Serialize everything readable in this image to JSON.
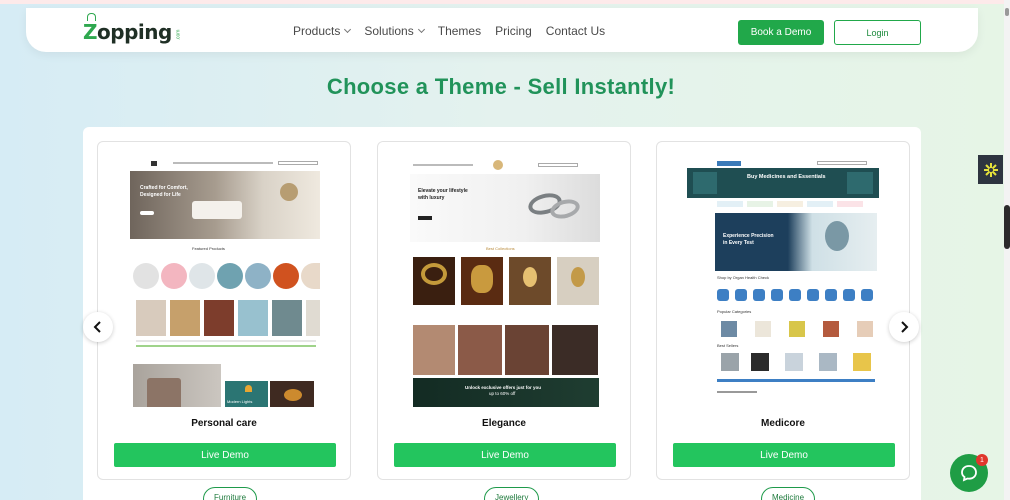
{
  "nav": {
    "logo_text": "Zopping",
    "logo_suffix": ".com",
    "menu": [
      {
        "label": "Products",
        "has_dropdown": true
      },
      {
        "label": "Solutions",
        "has_dropdown": true
      },
      {
        "label": "Themes",
        "has_dropdown": false
      },
      {
        "label": "Pricing",
        "has_dropdown": false
      },
      {
        "label": "Contact Us",
        "has_dropdown": false
      }
    ],
    "book_demo_label": "Book a Demo",
    "login_label": "Login"
  },
  "heading": "Choose a Theme - Sell Instantly!",
  "cards": [
    {
      "title": "Personal care",
      "button_label": "Live Demo",
      "tag": "Furniture",
      "preview": {
        "hero_line1": "Crafted for Comfort,",
        "hero_line2": "Designed for Life",
        "section_title": "Featured Products",
        "label_2": "Modern Lights"
      }
    },
    {
      "title": "Elegance",
      "button_label": "Live Demo",
      "tag": "Jewellery",
      "preview": {
        "hero_line1": "Elevate your lifestyle",
        "hero_line2": "with luxury",
        "section_title": "Best Collections",
        "banner_line1": "Unlock exclusive offers just for you",
        "banner_line2": "up to 60% off"
      }
    },
    {
      "title": "Medicore",
      "button_label": "Live Demo",
      "tag": "Medicine",
      "preview": {
        "top_banner": "Buy Medicines and Essentials",
        "hero_line1": "Experience Precision",
        "hero_line2": "in Every Test",
        "section_title": "Shop by Organ Health Check",
        "section_2": "Popular Categories",
        "section_3": "Best Sellers"
      }
    }
  ],
  "colors": {
    "brand_green": "#21a84a",
    "heading_green": "#21935a",
    "button_green": "#23c55e",
    "chat_badge": "#e0362c"
  },
  "icons": {
    "prev": "chevron-left-icon",
    "next": "chevron-right-icon",
    "chat": "chat-icon",
    "widget": "sun-icon"
  },
  "chat_badge_count": "1"
}
